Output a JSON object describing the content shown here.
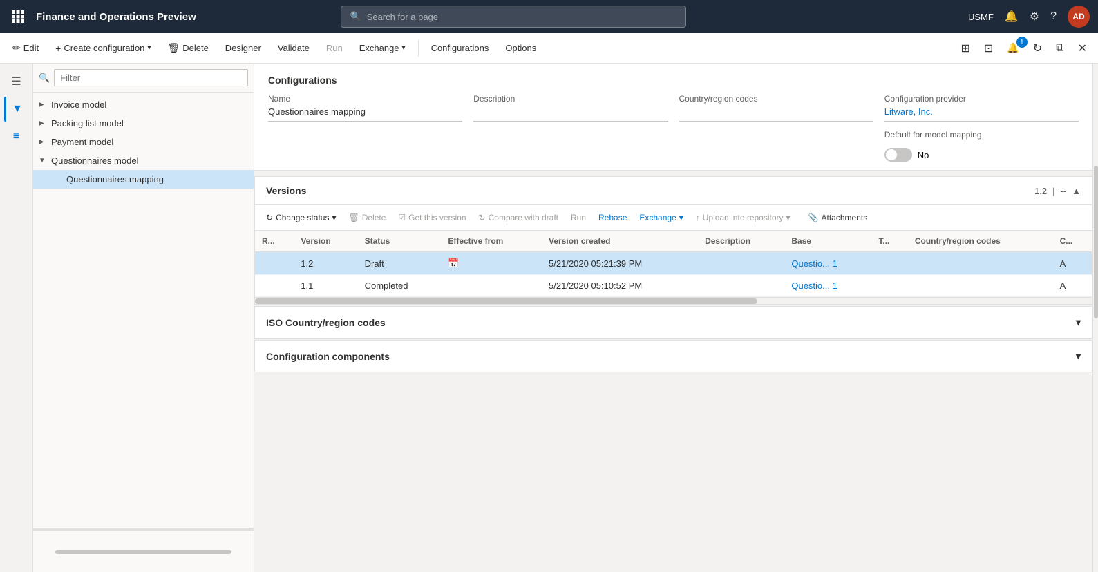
{
  "app": {
    "title": "Finance and Operations Preview",
    "search_placeholder": "Search for a page",
    "user_initials": "AD",
    "user_region": "USMF"
  },
  "command_bar": {
    "edit_label": "Edit",
    "create_config_label": "Create configuration",
    "delete_label": "Delete",
    "designer_label": "Designer",
    "validate_label": "Validate",
    "run_label": "Run",
    "exchange_label": "Exchange",
    "configurations_label": "Configurations",
    "options_label": "Options"
  },
  "sidebar_icons": [
    "≡",
    "⊞",
    "★",
    "⊙",
    "▦",
    "≡"
  ],
  "tree": {
    "filter_placeholder": "Filter",
    "items": [
      {
        "label": "Invoice model",
        "level": 0,
        "expanded": false
      },
      {
        "label": "Packing list model",
        "level": 0,
        "expanded": false
      },
      {
        "label": "Payment model",
        "level": 0,
        "expanded": false
      },
      {
        "label": "Questionnaires model",
        "level": 0,
        "expanded": true
      },
      {
        "label": "Questionnaires mapping",
        "level": 1,
        "expanded": false,
        "selected": true
      }
    ]
  },
  "detail": {
    "section_title": "Configurations",
    "fields": {
      "name_label": "Name",
      "name_value": "Questionnaires mapping",
      "description_label": "Description",
      "description_value": "",
      "country_label": "Country/region codes",
      "country_value": "",
      "provider_label": "Configuration provider",
      "provider_value": "Litware, Inc.",
      "default_mapping_label": "Default for model mapping",
      "default_mapping_value": "No",
      "default_mapping_toggle": false
    }
  },
  "versions": {
    "section_title": "Versions",
    "version_display": "1.2",
    "toolbar": {
      "change_status_label": "Change status",
      "delete_label": "Delete",
      "get_this_version_label": "Get this version",
      "compare_with_draft_label": "Compare with draft",
      "run_label": "Run",
      "rebase_label": "Rebase",
      "exchange_label": "Exchange",
      "upload_into_repo_label": "Upload into repository",
      "attachments_label": "Attachments"
    },
    "table": {
      "columns": [
        "R...",
        "Version",
        "Status",
        "Effective from",
        "Version created",
        "Description",
        "Base",
        "T...",
        "Country/region codes",
        "C..."
      ],
      "rows": [
        {
          "r": "",
          "version": "1.2",
          "status": "Draft",
          "effective_from": "",
          "version_created": "5/21/2020 05:21:39 PM",
          "description": "",
          "base": "Questio...",
          "base_num": "1",
          "t": "",
          "country": "",
          "c": "A",
          "selected": true
        },
        {
          "r": "",
          "version": "1.1",
          "status": "Completed",
          "effective_from": "",
          "version_created": "5/21/2020 05:10:52 PM",
          "description": "",
          "base": "Questio...",
          "base_num": "1",
          "t": "",
          "country": "",
          "c": "A",
          "selected": false
        }
      ]
    }
  },
  "iso_section": {
    "title": "ISO Country/region codes"
  },
  "config_components_section": {
    "title": "Configuration components"
  }
}
